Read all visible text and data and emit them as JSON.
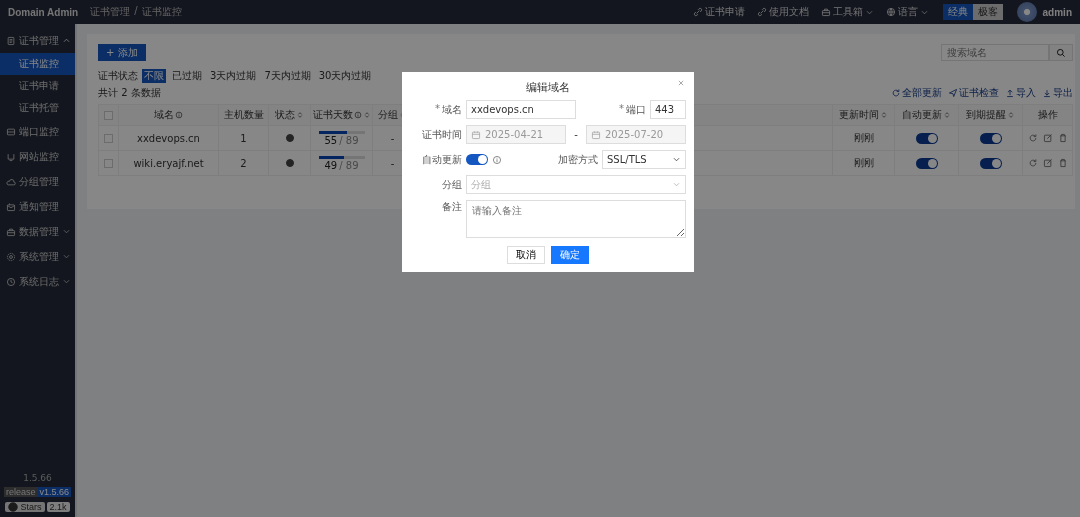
{
  "topbar": {
    "brand": "Domain Admin",
    "breadcrumb": [
      "证书管理",
      "证书监控"
    ],
    "breadcrumb_separator": "/",
    "links": [
      {
        "label": "证书申请",
        "dropdown": false
      },
      {
        "label": "使用文档",
        "dropdown": false
      },
      {
        "label": "工具箱",
        "dropdown": true
      },
      {
        "label": "语言",
        "dropdown": true
      }
    ],
    "theme_switch": [
      {
        "label": "经典",
        "selected": true
      },
      {
        "label": "极客",
        "selected": false
      }
    ],
    "user": "admin"
  },
  "sidebar": {
    "items": [
      {
        "label": "证书管理",
        "expanded": true,
        "children": [
          {
            "label": "证书监控",
            "selected": true
          },
          {
            "label": "证书申请",
            "selected": false
          },
          {
            "label": "证书托管",
            "selected": false
          }
        ]
      },
      {
        "label": "端口监控"
      },
      {
        "label": "网站监控"
      },
      {
        "label": "分组管理"
      },
      {
        "label": "通知管理"
      },
      {
        "label": "数据管理",
        "expanded": false
      },
      {
        "label": "系统管理",
        "expanded": false
      },
      {
        "label": "系统日志",
        "expanded": false
      }
    ],
    "version": "1.5.66",
    "release_badge": [
      "release",
      "v1.5.66"
    ],
    "stars_badge": [
      "Stars",
      "2.1k"
    ]
  },
  "toolbar": {
    "add_button": "+ 添加",
    "search": {
      "placeholder": "搜索域名"
    }
  },
  "filter": {
    "label": "证书状态",
    "options": [
      {
        "label": "不限",
        "selected": true
      },
      {
        "label": "已过期",
        "selected": false
      },
      {
        "label": "3天内过期",
        "selected": false
      },
      {
        "label": "7天内过期",
        "selected": false
      },
      {
        "label": "30天内过期",
        "selected": false
      }
    ]
  },
  "total": "共计 2 条数据",
  "actions": [
    {
      "label": "全部更新"
    },
    {
      "label": "证书检查"
    },
    {
      "label": "导入"
    },
    {
      "label": "导出"
    }
  ],
  "table": {
    "all_checked": false,
    "columns": [
      {
        "label": "域名",
        "info": true,
        "sort": false
      },
      {
        "label": "主机数量",
        "info": false,
        "sort": false
      },
      {
        "label": "状态",
        "info": false,
        "sort": true
      },
      {
        "label": "证书天数",
        "info": true,
        "sort": true
      },
      {
        "label": "分组",
        "info": false,
        "sort": true
      },
      {
        "label": "更新时间",
        "info": false,
        "sort": true
      },
      {
        "label": "自动更新",
        "info": false,
        "sort": true
      },
      {
        "label": "到期提醒",
        "info": false,
        "sort": true
      },
      {
        "label": "操作",
        "info": false,
        "sort": false
      }
    ],
    "rows": [
      {
        "checked": false,
        "domain": "xxdevops.cn",
        "hosts": "1",
        "status_ok": true,
        "days_left": "55",
        "days_total": "/ 89",
        "level": 0.62,
        "group": "-",
        "updated": "刚刚",
        "auto_update": true,
        "expiry_alert": true
      },
      {
        "checked": false,
        "domain": "wiki.eryajf.net",
        "hosts": "2",
        "status_ok": true,
        "days_left": "49",
        "days_total": "/ 89",
        "level": 0.55,
        "group": "-",
        "updated": "刚刚",
        "auto_update": true,
        "expiry_alert": true
      }
    ]
  },
  "dialog": {
    "title": "编辑域名",
    "required_mark": "*",
    "domain_label": "域名",
    "domain_value": "xxdevops.cn",
    "port_label": "端口",
    "port_value": "443",
    "cert_time_label": "证书时间",
    "start_date": "2025-04-21",
    "date_separator": "-",
    "end_date": "2025-07-20",
    "dates_disabled": true,
    "auto_update_label": "自动更新",
    "auto_update": true,
    "encryption_label": "加密方式",
    "encryption_value": "SSL/TLS",
    "group_label": "分组",
    "group_placeholder": "分组",
    "note_label": "备注",
    "note_placeholder": "请输入备注",
    "cancel": "取消",
    "confirm": "确定"
  }
}
